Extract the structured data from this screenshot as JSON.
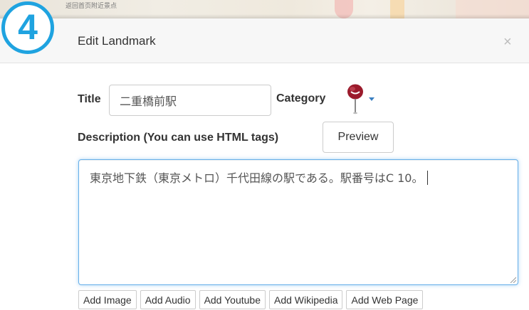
{
  "map": {
    "text": "返回首页附近景点"
  },
  "step": {
    "number": "4",
    "color": "#1fa3e0"
  },
  "modal": {
    "title": "Edit Landmark",
    "close": "×"
  },
  "form": {
    "title_label": "Title",
    "title_value": "二重橋前駅",
    "category_label": "Category",
    "category_icon": "map-pin-icon",
    "description_label": "Description (You can use HTML tags)",
    "preview_label": "Preview",
    "description_value": "東京地下鉄（東京メトロ）千代田線の駅である。駅番号はC 10。"
  },
  "add_buttons": [
    "Add Image",
    "Add Audio",
    "Add Youtube",
    "Add Wikipedia",
    "Add Web Page"
  ],
  "colors": {
    "accent": "#1fa3e0",
    "focus_border": "#66afe9",
    "pin": "#9b1b2c"
  }
}
